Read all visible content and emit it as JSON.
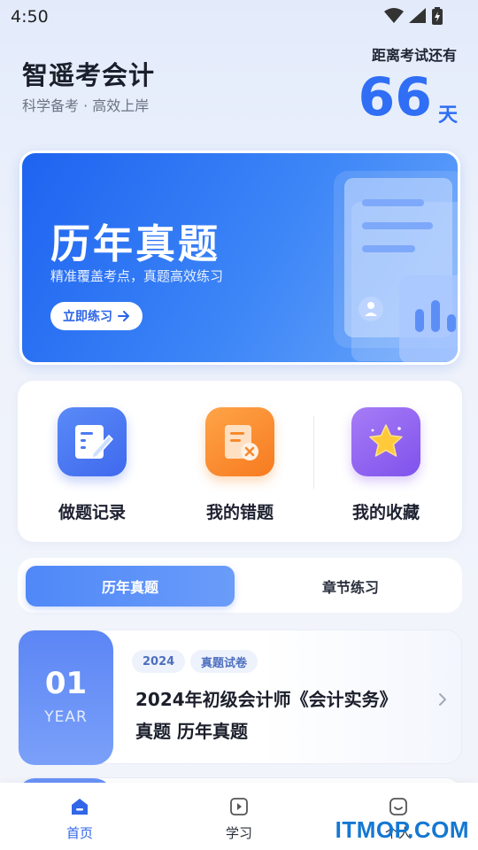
{
  "status_bar": {
    "time": "4:50",
    "icons": [
      "wifi-icon",
      "signal-icon",
      "battery-icon"
    ]
  },
  "header": {
    "title": "智遥考会计",
    "subtitle": "科学备考 · 高效上岸",
    "countdown_label": "距离考试还有",
    "countdown_days": "66",
    "countdown_unit": "天"
  },
  "banner": {
    "title": "历年真题",
    "subtitle": "精准覆盖考点，真题高效练习",
    "button_label": "立即练习",
    "button_icon": "arrow-right-icon"
  },
  "quick_actions": [
    {
      "label": "做题记录",
      "icon": "notebook-edit-icon",
      "color": "#4c78f2"
    },
    {
      "label": "我的错题",
      "icon": "document-error-icon",
      "color": "#fb8c2c"
    },
    {
      "label": "我的收藏",
      "icon": "star-icon",
      "color": "#9b6cf1"
    }
  ],
  "tabs": [
    {
      "label": "历年真题",
      "active": true
    },
    {
      "label": "章节练习",
      "active": false
    }
  ],
  "exam_list": [
    {
      "number": "01",
      "number_caption": "YEAR",
      "tags": [
        "2024",
        "真题试卷"
      ],
      "title": "2024年初级会计师《会计实务》真题 历年真题"
    }
  ],
  "bottom_nav": [
    {
      "label": "首页",
      "icon": "home-icon",
      "active": true
    },
    {
      "label": "学习",
      "icon": "play-square-icon",
      "active": false
    },
    {
      "label": "个人",
      "icon": "smile-icon",
      "active": false
    }
  ],
  "watermark": "ITMOP.COM",
  "colors": {
    "accent": "#2f6ef5",
    "active_nav": "#3266e8"
  }
}
